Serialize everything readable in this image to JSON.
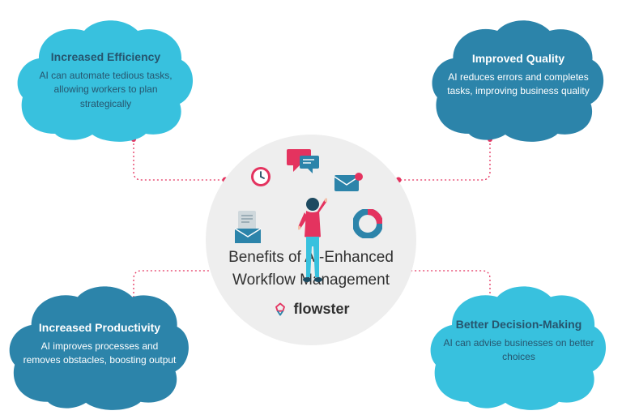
{
  "center": {
    "title": "Benefits of AI-Enhanced Workflow Management",
    "brand": "flowster"
  },
  "clouds": {
    "top_left": {
      "title": "Increased Efficiency",
      "desc": "AI can automate tedious tasks, allowing workers to plan strategically"
    },
    "top_right": {
      "title": "Improved Quality",
      "desc": "AI reduces errors and completes tasks, improving business quality"
    },
    "bottom_left": {
      "title": "Increased Productivity",
      "desc": "AI improves processes and removes obstacles, boosting output"
    },
    "bottom_right": {
      "title": "Better Decision-Making",
      "desc": "AI can advise businesses on better choices"
    }
  },
  "colors": {
    "light_teal": "#38c1de",
    "dark_teal": "#2c84aa",
    "pink": "#e4335f",
    "grey": "#eeeeee",
    "text_dark": "#26556e"
  }
}
